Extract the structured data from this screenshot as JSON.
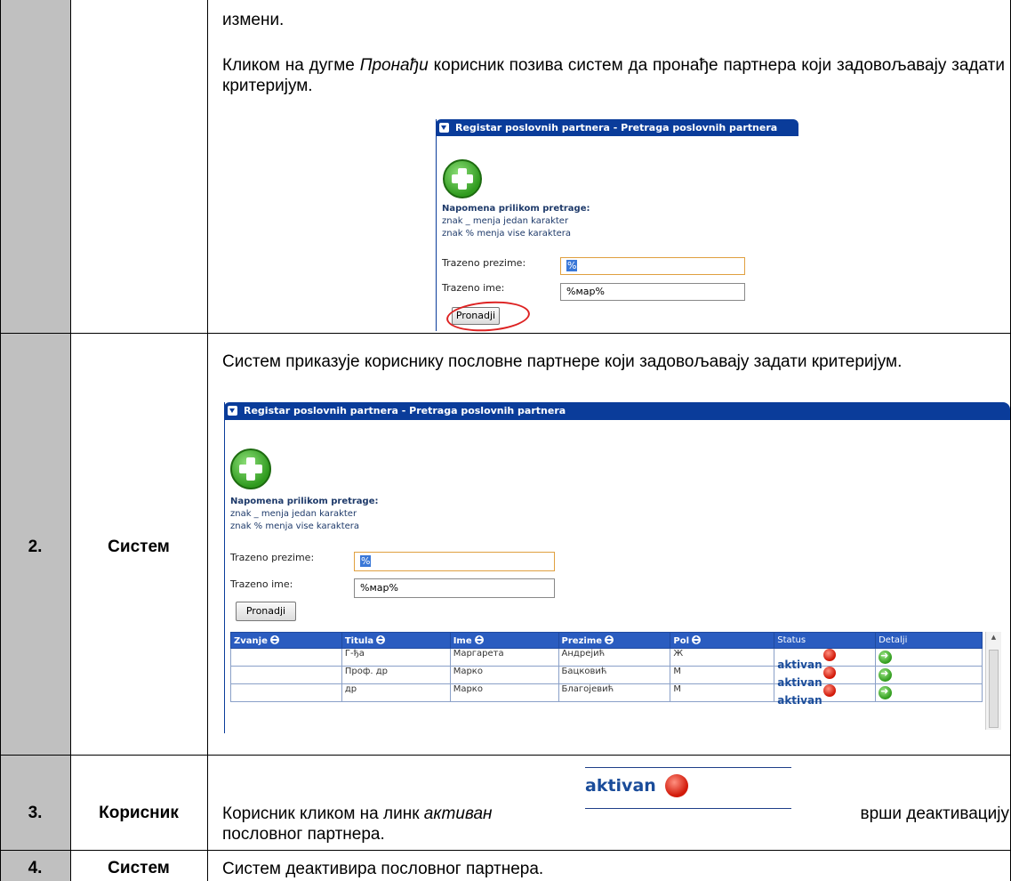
{
  "rows": [
    {
      "num": "",
      "actor": "",
      "text_lines": [
        "измени."
      ],
      "paragraph": {
        "before": "Кликом на дугме ",
        "em": "Пронађи",
        "after": " корисник позива систем да пронађе партнера који задовољавају задати критеријум."
      },
      "screenshot": {
        "title": "Registar poslovnih partnera - Pretraga poslovnih partnera",
        "note_heading": "Napomena prilikom pretrage:",
        "note_1": "znak _ menja jedan karakter",
        "note_2": "znak % menja vise karaktera",
        "label_surname": "Trazeno prezime:",
        "value_surname": "%",
        "label_name": "Trazeno ime:",
        "value_name": "%мар%",
        "button": "Pronadji"
      }
    },
    {
      "num": "2.",
      "actor": "Систем",
      "text": "Систем приказује кориснику пословне партнере који задовољавају задати критеријум.",
      "screenshot": {
        "title": "Registar poslovnih partnera - Pretraga poslovnih partnera",
        "note_heading": "Napomena prilikom pretrage:",
        "note_1": "znak _ menja jedan karakter",
        "note_2": "znak % menja vise karaktera",
        "label_surname": "Trazeno prezime:",
        "value_surname": "%",
        "label_name": "Trazeno ime:",
        "value_name": "%мар%",
        "button": "Pronadji",
        "columns": [
          "Zvanje",
          "Titula",
          "Ime",
          "Prezime",
          "Pol",
          "Status",
          "Detalji"
        ],
        "results": [
          {
            "zvanje": "",
            "titula": "Г-ђа",
            "ime": "Маргарета",
            "prezime": "Андрејић",
            "pol": "Ж",
            "status": "aktivan"
          },
          {
            "zvanje": "",
            "titula": "Проф. др",
            "ime": "Марко",
            "prezime": "Бацковић",
            "pol": "М",
            "status": "aktivan"
          },
          {
            "zvanje": "",
            "titula": "др",
            "ime": "Марко",
            "prezime": "Благојевић",
            "pol": "М",
            "status": "aktivan"
          }
        ]
      }
    },
    {
      "num": "3.",
      "actor": "Корисник",
      "text_before": "Корисник кликом на линк ",
      "text_em": "активан",
      "link_image_label": "aktivan",
      "text_after": " врши деактивацију",
      "text_line2": "пословног партнера."
    },
    {
      "num": "4.",
      "actor": "Систем",
      "text": "Систем деактивира пословног партнера."
    }
  ],
  "colors": {
    "num_column": "#c0c0c0",
    "ui_header": "#0a3c9a",
    "grid_header": "#2a5cc0",
    "highlight_circle": "#dd2222"
  }
}
